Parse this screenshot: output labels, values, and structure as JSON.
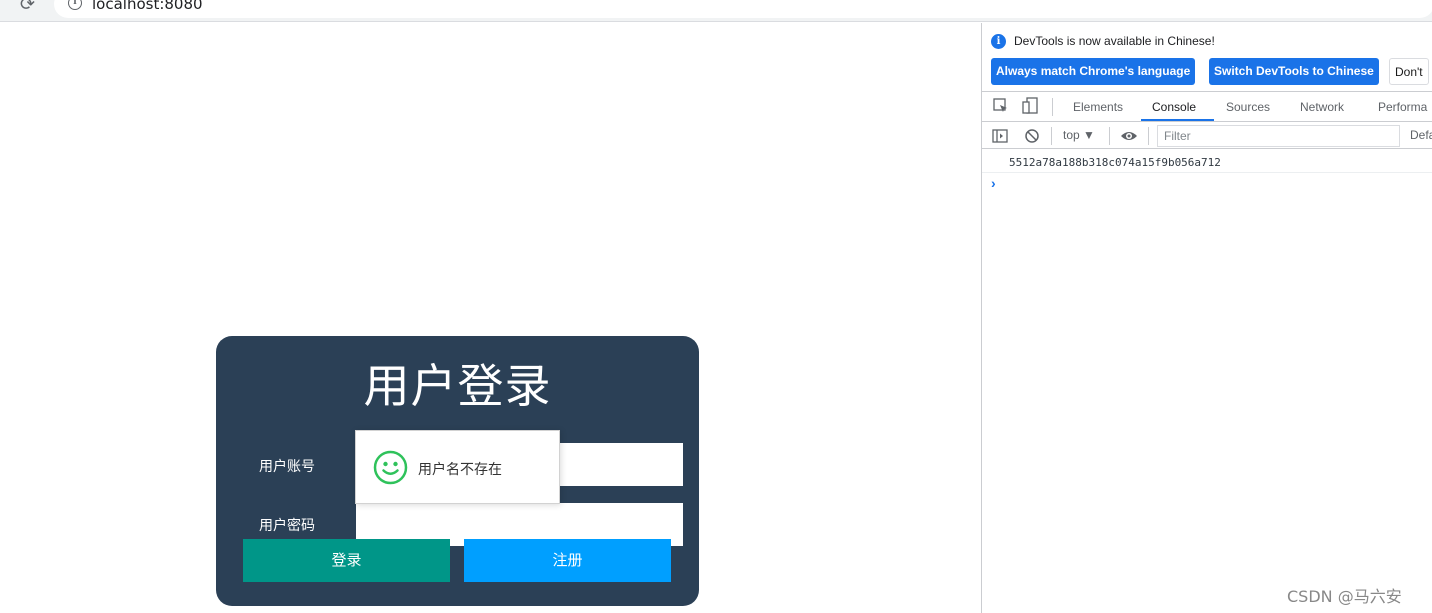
{
  "browser": {
    "url": "localhost:8080"
  },
  "login": {
    "title": "用户登录",
    "account_label": "用户账号",
    "password_label": "用户密码",
    "login_button": "登录",
    "register_button": "注册"
  },
  "toast": {
    "message": "用户名不存在",
    "icon": "smile-icon",
    "icon_color": "#2fc25b"
  },
  "devtools": {
    "notice": "DevTools is now available in Chinese!",
    "buttons": {
      "match_language": "Always match Chrome's language",
      "switch_chinese": "Switch DevTools to Chinese",
      "dont_show": "Don't"
    },
    "tabs": {
      "elements": "Elements",
      "console": "Console",
      "sources": "Sources",
      "network": "Network",
      "performance": "Performa"
    },
    "active_tab": "Console",
    "toolbar": {
      "context": "top ▼",
      "filter_placeholder": "Filter",
      "levels": "Defa"
    },
    "console_output": [
      "5512a78a188b318c074a15f9b056a712"
    ],
    "prompt": "›",
    "accent_color": "#1a73e8"
  },
  "watermark": "CSDN @马六安",
  "colors": {
    "card_bg": "#2b4056",
    "login_btn": "#009688",
    "register_btn": "#009fff"
  }
}
